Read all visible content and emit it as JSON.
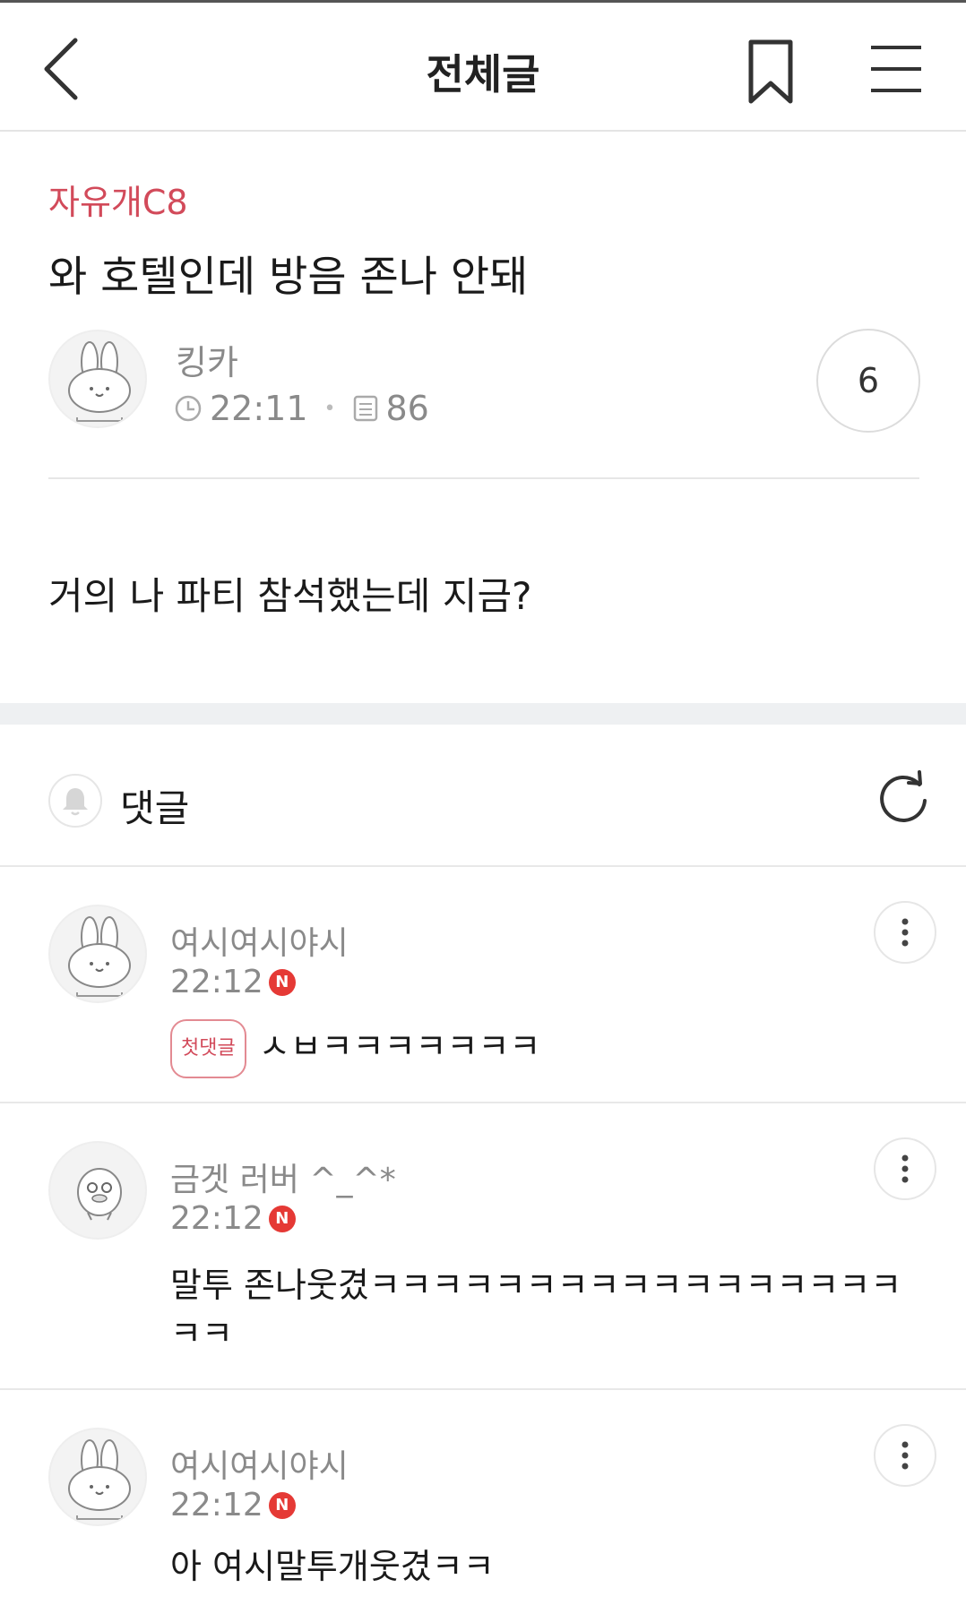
{
  "header": {
    "title": "전체글"
  },
  "post": {
    "board": "자유개C8",
    "title": "와 호텔인데 방음 존나 안돼",
    "author": "킹카",
    "time": "22:11",
    "views": "86",
    "comment_count": "6",
    "body": "거의 나 파티 참석했는데 지금?"
  },
  "comments_section": {
    "label": "댓글"
  },
  "comments": [
    {
      "author": "여시여시야시",
      "time": "22:12",
      "new_badge": "N",
      "first_badge": "첫댓글",
      "text": "ㅅㅂㅋㅋㅋㅋㅋㅋㅋ"
    },
    {
      "author": "금겟 러버 ^_^*",
      "time": "22:12",
      "new_badge": "N",
      "text": "말투 존나웃겼ㅋㅋㅋㅋㅋㅋㅋㅋㅋㅋㅋㅋㅋㅋㅋㅋㅋ ㅋㅋ"
    },
    {
      "author": "여시여시야시",
      "time": "22:12",
      "new_badge": "N",
      "text": "아 여시말투개웃겼ㅋㅋ"
    }
  ],
  "colors": {
    "accent": "#d24a5a",
    "new_badge": "#e53935",
    "muted_text": "#8a8a8a",
    "divider": "#e8e8e8",
    "section_gap": "#eef0f2"
  },
  "icons": [
    "back-arrow-icon",
    "bookmark-icon",
    "hamburger-menu-icon",
    "clock-icon",
    "views-icon",
    "bell-icon",
    "refresh-icon",
    "more-vertical-icon",
    "rabbit-avatar-icon",
    "duck-avatar-icon"
  ]
}
